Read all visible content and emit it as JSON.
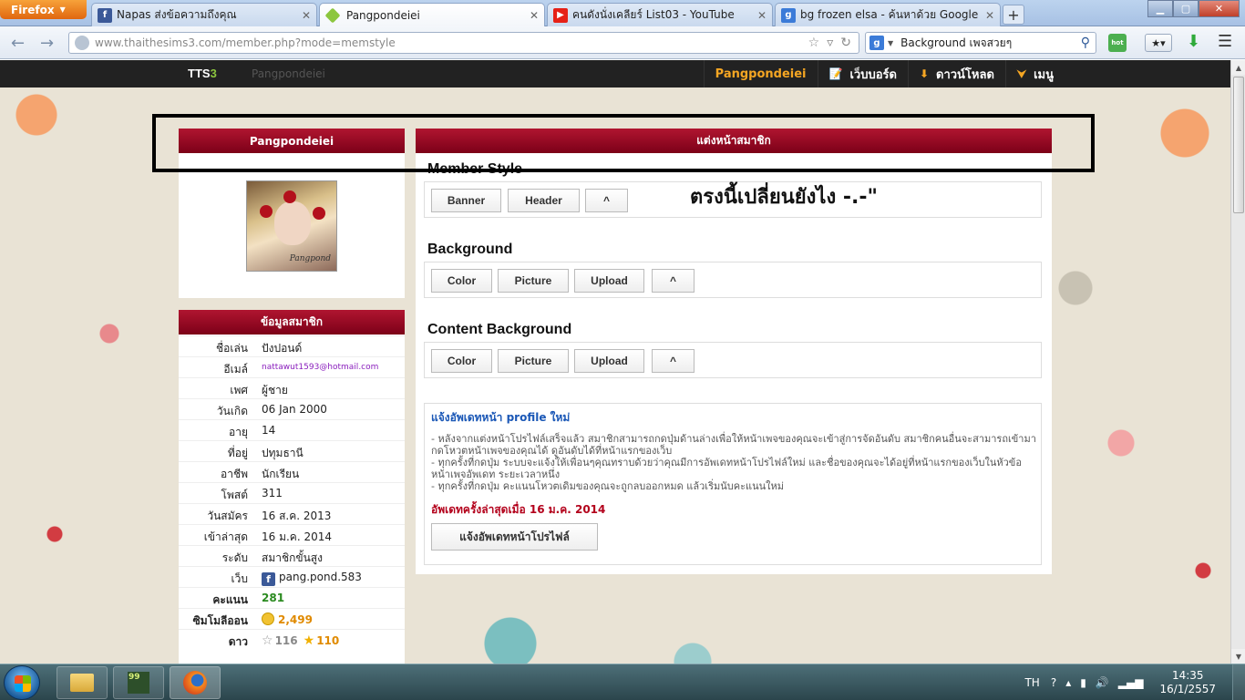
{
  "browser": {
    "menu_button": "Firefox",
    "tabs": [
      {
        "label": "Napas ส่งข้อความถึงคุณ",
        "icon": "facebook-icon",
        "active": false
      },
      {
        "label": "Pangpondeiei",
        "icon": "tts3-icon",
        "active": true
      },
      {
        "label": "คนดังนั่งเคลียร์ List03 - YouTube",
        "icon": "youtube-icon",
        "active": false
      },
      {
        "label": "bg frozen elsa - ค้นหาด้วย Google",
        "icon": "google-icon",
        "active": false
      }
    ],
    "url_host": "www.thaithesims3.com",
    "url_path": "/member.php?mode=memstyle",
    "search_value": "Background เพจสวยๆ"
  },
  "site": {
    "logo_main": "TTS",
    "logo_accent": "3",
    "crumb": "Pangpondeiei",
    "nav": {
      "user": "Pangpondeiei",
      "webboard": "เว็บบอร์ด",
      "download": "ดาวน์โหลด",
      "menu": "เมนู"
    }
  },
  "profile": {
    "title": "Pangpondeiei",
    "avatar_signature": "Pangpond"
  },
  "member_info": {
    "title": "ข้อมูลสมาชิก",
    "rows": [
      {
        "label": "ชื่อเล่น",
        "value": "ปังปอนด์"
      },
      {
        "label": "อีเมล์",
        "value": "nattawut1593@hotmail.com"
      },
      {
        "label": "เพศ",
        "value": "ผู้ชาย"
      },
      {
        "label": "วันเกิด",
        "value": "06 Jan 2000"
      },
      {
        "label": "อายุ",
        "value": "14"
      },
      {
        "label": "ที่อยู่",
        "value": "ปทุมธานี"
      },
      {
        "label": "อาชีพ",
        "value": "นักเรียน"
      },
      {
        "label": "โพสต์",
        "value": "311"
      },
      {
        "label": "วันสมัคร",
        "value": "16 ส.ค. 2013"
      },
      {
        "label": "เข้าล่าสุด",
        "value": "16 ม.ค. 2014"
      },
      {
        "label": "ระดับ",
        "value": "สมาชิกขั้นสูง"
      },
      {
        "label": "เว็บ",
        "value": "pang.pond.583"
      },
      {
        "label": "คะแนน",
        "value": "281"
      },
      {
        "label": "ซิมโมลีออน",
        "value": "2,499"
      },
      {
        "label": "ดาว",
        "value_gray": "116",
        "value_gold": "110"
      }
    ]
  },
  "main": {
    "title": "แต่งหน้าสมาชิก",
    "annotation": "ตรงนี้เปลี่ยนยังไง   -.-\"",
    "sections": {
      "member_style": {
        "title": "Member Style",
        "buttons": [
          "Banner",
          "Header",
          "^"
        ]
      },
      "background": {
        "title": "Background",
        "buttons": [
          "Color",
          "Picture",
          "Upload",
          "^"
        ]
      },
      "content_background": {
        "title": "Content Background",
        "buttons": [
          "Color",
          "Picture",
          "Upload",
          "^"
        ]
      }
    },
    "notice": {
      "title": "แจ้งอัพเดทหน้า profile ใหม่",
      "line1": "- หลังจากแต่งหน้าโปรไฟล์เสร็จแล้ว สมาชิกสามารถกดปุ่มด้านล่างเพื่อให้หน้าเพจของคุณจะเข้าสู่การจัดอันดับ สมาชิกคนอื่นจะสามารถเข้ามากดโหวตหน้าเพจของคุณได้ ดูอันดับได้ที่หน้าแรกของเว็บ",
      "line2": "- ทุกครั้งที่กดปุ่ม ระบบจะแจ้งให้เพื่อนๆคุณทราบด้วยว่าคุณมีการอัพเดทหน้าโปรไฟล์ใหม่ และชื่อของคุณจะได้อยู่ที่หน้าแรกของเว็บในหัวข้อ หน้าเพจอัพเดท ระยะเวลาหนึ่ง",
      "line3": "- ทุกครั้งที่กดปุ่ม คะแนนโหวตเดิมของคุณจะถูกลบออกหมด แล้วเริ่มนับคะแนนใหม่",
      "last_update": "อัพเดทครั้งล่าสุดเมื่อ 16 ม.ค. 2014",
      "button": "แจ้งอัพเดทหน้าโปรไฟล์"
    }
  },
  "taskbar": {
    "language": "TH",
    "time": "14:35",
    "date": "16/1/2557",
    "sims_icon_text": "99"
  },
  "colors": {
    "accent_red": "#8c0a22",
    "site_header": "#222222",
    "user_orange": "#f5a623",
    "link_blue": "#1a57b6"
  }
}
